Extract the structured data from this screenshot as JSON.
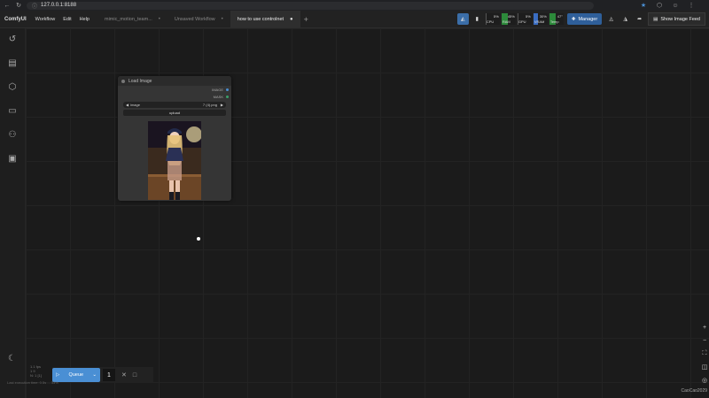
{
  "browser": {
    "url": "127.0.0.1:8188"
  },
  "app": {
    "name": "ComfyUI",
    "menu": [
      "Workflow",
      "Edit",
      "Help"
    ]
  },
  "tabs": [
    {
      "label": "mimic_motion_team...",
      "close": "•",
      "active": false
    },
    {
      "label": "Unsaved Workflow",
      "close": "•",
      "active": false
    },
    {
      "label": "how to use controlnet",
      "close": "●",
      "active": true
    }
  ],
  "toolbar": {
    "meters": [
      {
        "label": "CPU",
        "pct": "5%",
        "color": "#1d1d1d"
      },
      {
        "label": "RAM",
        "pct": "45%",
        "color": "#2c8a3a"
      },
      {
        "label": "GPU",
        "pct": "5%",
        "color": "#1d1d1d"
      },
      {
        "label": "VRAM",
        "pct": "30%",
        "color": "#3a6dc2"
      },
      {
        "label": "Temp",
        "pct": "47°",
        "color": "#2c8a3a"
      }
    ],
    "manager_label": "Manager",
    "feed_label": "Show Image Feed"
  },
  "node": {
    "title": "Load Image",
    "outputs": [
      {
        "label": "IMAGE",
        "color": "#4a8fd4"
      },
      {
        "label": "MASK",
        "color": "#3aa06a"
      }
    ],
    "image_widget_label": "image",
    "image_widget_value": "7 (4).png",
    "upload_label": "upload"
  },
  "queue": {
    "label": "Queue",
    "batch_count": "1"
  },
  "stats": [
    "1.1 fps",
    "1 9",
    "N: 1 [1]"
  ],
  "status_text": "Last execution time: 0.5s ... 33%",
  "watermark": "CaoCao2029"
}
